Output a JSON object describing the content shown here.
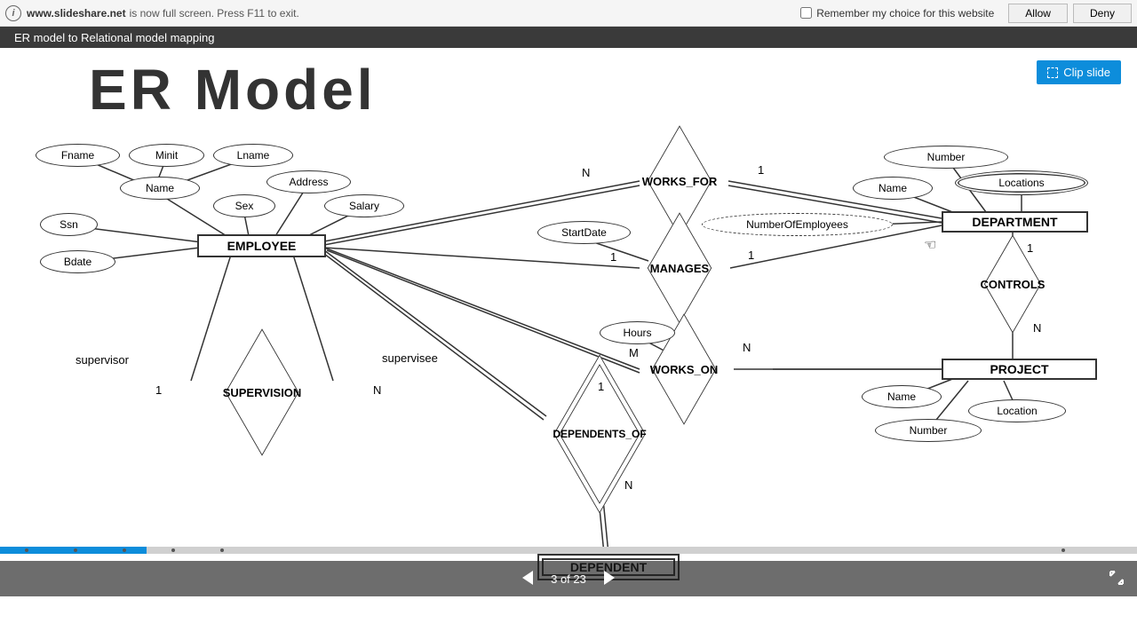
{
  "fullscreen": {
    "domain": "www.slideshare.net",
    "message": "is now full screen. Press F11 to exit.",
    "remember_label": "Remember my choice for this website",
    "allow": "Allow",
    "deny": "Deny"
  },
  "title_bar": "ER model to Relational model mapping",
  "clip_label": "Clip slide",
  "slide_title": "ER Model",
  "entities": {
    "employee": "EMPLOYEE",
    "department": "DEPARTMENT",
    "project": "PROJECT",
    "dependent": "DEPENDENT"
  },
  "relationships": {
    "works_for": "WORKS_FOR",
    "manages": "MANAGES",
    "controls": "CONTROLS",
    "works_on": "WORKS_ON",
    "supervision": "SUPERVISION",
    "dependents_of": "DEPENDENTS_OF"
  },
  "attributes": {
    "fname": "Fname",
    "minit": "Minit",
    "lname": "Lname",
    "name": "Name",
    "address": "Address",
    "sex": "Sex",
    "salary": "Salary",
    "ssn": "Ssn",
    "bdate": "Bdate",
    "dept_number": "Number",
    "dept_name": "Name",
    "locations": "Locations",
    "num_employees": "NumberOfEmployees",
    "start_date": "StartDate",
    "hours": "Hours",
    "proj_name": "Name",
    "proj_location": "Location",
    "proj_number": "Number"
  },
  "cardinality": {
    "n": "N",
    "one": "1",
    "m": "M"
  },
  "roles": {
    "supervisor": "supervisor",
    "supervisee": "supervisee"
  },
  "nav": {
    "page": "3 of 23"
  }
}
